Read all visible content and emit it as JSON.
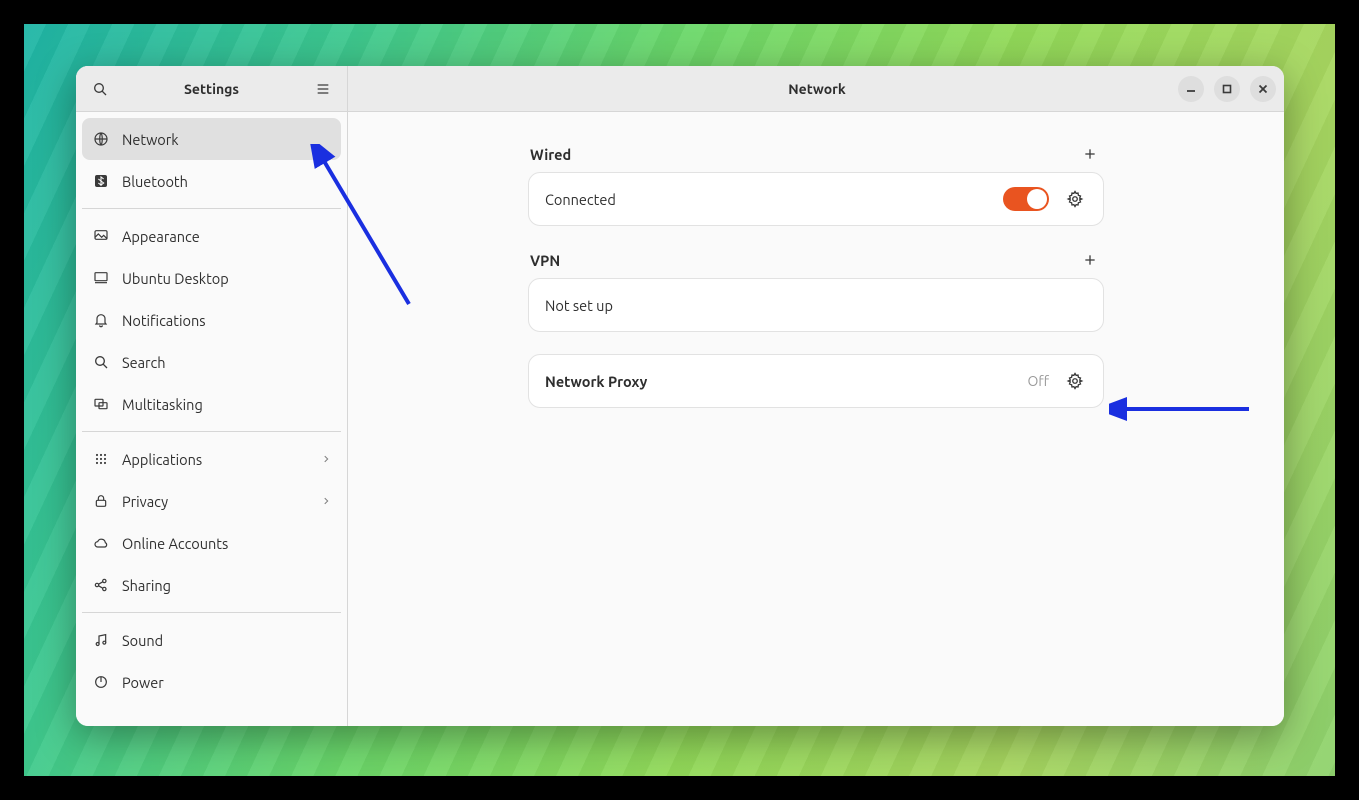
{
  "sidebar": {
    "title": "Settings",
    "groups": [
      [
        {
          "id": "network",
          "label": "Network",
          "icon": "globe-icon",
          "active": true
        },
        {
          "id": "bluetooth",
          "label": "Bluetooth",
          "icon": "bluetooth-icon"
        }
      ],
      [
        {
          "id": "appearance",
          "label": "Appearance",
          "icon": "appearance-icon"
        },
        {
          "id": "ubuntu-desktop",
          "label": "Ubuntu Desktop",
          "icon": "desktop-icon"
        },
        {
          "id": "notifications",
          "label": "Notifications",
          "icon": "bell-icon"
        },
        {
          "id": "search",
          "label": "Search",
          "icon": "search-icon"
        },
        {
          "id": "multitasking",
          "label": "Multitasking",
          "icon": "multitasking-icon"
        }
      ],
      [
        {
          "id": "applications",
          "label": "Applications",
          "icon": "grid-icon",
          "chevron": true
        },
        {
          "id": "privacy",
          "label": "Privacy",
          "icon": "lock-icon",
          "chevron": true
        },
        {
          "id": "online-accounts",
          "label": "Online Accounts",
          "icon": "cloud-icon"
        },
        {
          "id": "sharing",
          "label": "Sharing",
          "icon": "share-icon"
        }
      ],
      [
        {
          "id": "sound",
          "label": "Sound",
          "icon": "note-icon"
        },
        {
          "id": "power",
          "label": "Power",
          "icon": "power-icon"
        }
      ]
    ]
  },
  "main": {
    "title": "Network",
    "wired": {
      "header": "Wired",
      "status": "Connected",
      "toggle_on": true
    },
    "vpn": {
      "header": "VPN",
      "status": "Not set up"
    },
    "proxy": {
      "label": "Network Proxy",
      "status": "Off"
    }
  },
  "colors": {
    "accent": "#e95420"
  }
}
